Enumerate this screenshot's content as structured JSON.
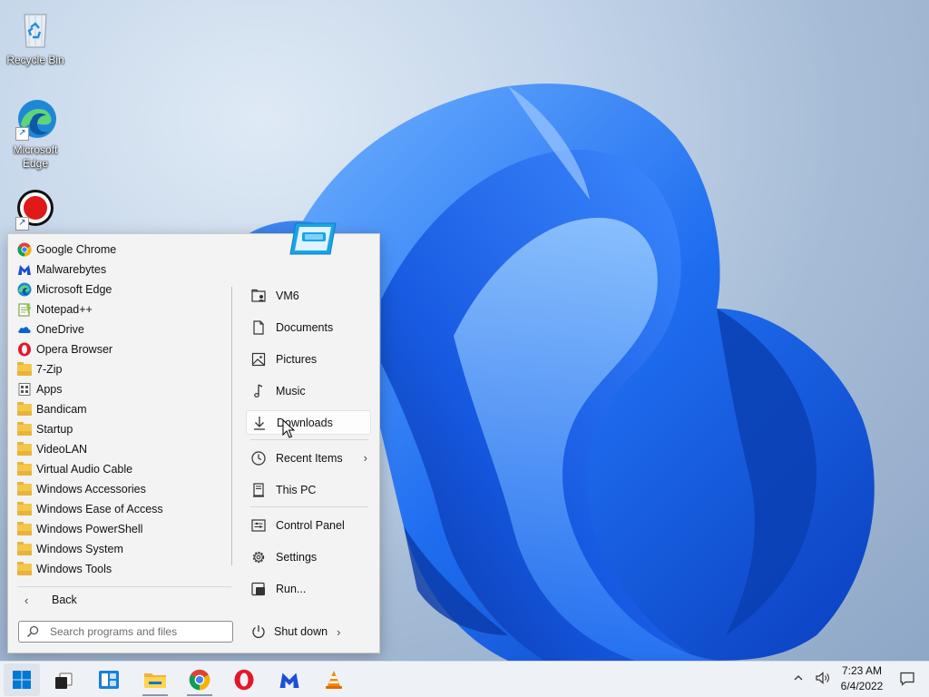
{
  "desktop": {
    "icons": [
      {
        "label": "Recycle Bin",
        "icon": "recycle-bin-icon"
      },
      {
        "label": "Microsoft Edge",
        "icon": "edge-icon"
      },
      {
        "label": "",
        "icon": "bandicam-icon"
      }
    ]
  },
  "start_menu": {
    "programs": [
      {
        "label": "Google Chrome",
        "icon": "chrome-icon"
      },
      {
        "label": "Malwarebytes",
        "icon": "malwarebytes-icon"
      },
      {
        "label": "Microsoft Edge",
        "icon": "edge-icon"
      },
      {
        "label": "Notepad++",
        "icon": "notepad-plus-plus-icon"
      },
      {
        "label": "OneDrive",
        "icon": "onedrive-icon"
      },
      {
        "label": "Opera Browser",
        "icon": "opera-icon"
      },
      {
        "label": "7-Zip",
        "icon": "folder-icon"
      },
      {
        "label": "Apps",
        "icon": "apps-icon"
      },
      {
        "label": "Bandicam",
        "icon": "folder-icon"
      },
      {
        "label": "Startup",
        "icon": "folder-icon"
      },
      {
        "label": "VideoLAN",
        "icon": "folder-icon"
      },
      {
        "label": "Virtual Audio Cable",
        "icon": "folder-icon"
      },
      {
        "label": "Windows Accessories",
        "icon": "folder-icon"
      },
      {
        "label": "Windows Ease of Access",
        "icon": "folder-icon"
      },
      {
        "label": "Windows PowerShell",
        "icon": "folder-icon"
      },
      {
        "label": "Windows System",
        "icon": "folder-icon"
      },
      {
        "label": "Windows Tools",
        "icon": "folder-icon"
      }
    ],
    "back_label": "Back",
    "search_placeholder": "Search programs and files",
    "places": [
      {
        "label": "VM6",
        "icon": "user-folder-icon"
      },
      {
        "label": "Documents",
        "icon": "documents-icon"
      },
      {
        "label": "Pictures",
        "icon": "pictures-icon"
      },
      {
        "label": "Music",
        "icon": "music-icon"
      },
      {
        "label": "Downloads",
        "icon": "downloads-icon"
      },
      {
        "label": "Recent Items",
        "icon": "recent-items-icon"
      },
      {
        "label": "This PC",
        "icon": "this-pc-icon"
      },
      {
        "label": "Control Panel",
        "icon": "control-panel-icon"
      },
      {
        "label": "Settings",
        "icon": "settings-gear-icon"
      },
      {
        "label": "Run...",
        "icon": "run-icon"
      }
    ],
    "shutdown_label": "Shut down"
  },
  "taskbar": {
    "apps": [
      {
        "name": "start",
        "icon": "windows-start-icon"
      },
      {
        "name": "task-view",
        "icon": "task-view-icon"
      },
      {
        "name": "widgets",
        "icon": "widgets-icon"
      },
      {
        "name": "file-explorer",
        "icon": "file-explorer-icon"
      },
      {
        "name": "chrome",
        "icon": "chrome-icon"
      },
      {
        "name": "opera",
        "icon": "opera-icon"
      },
      {
        "name": "malwarebytes",
        "icon": "malwarebytes-icon"
      },
      {
        "name": "vlc",
        "icon": "vlc-icon"
      }
    ],
    "time": "7:23 AM",
    "date": "6/4/2022"
  },
  "colors": {
    "accent": "#0067c0",
    "taskbar_bg": "#eef1f6",
    "menu_bg": "#f3f3f3"
  }
}
